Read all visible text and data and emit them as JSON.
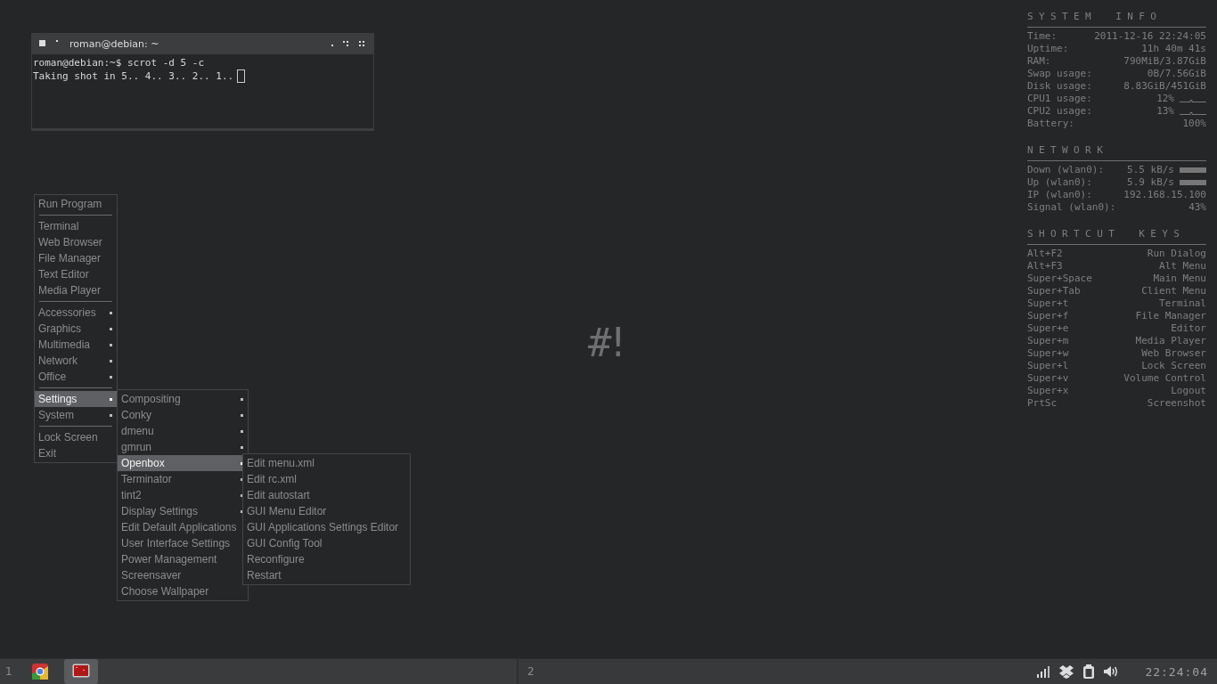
{
  "terminal": {
    "title": "roman@debian: ~",
    "lines": [
      "roman@debian:~$ scrot -d 5 -c",
      "Taking shot in 5.. 4.. 3.. 2.. 1.."
    ]
  },
  "menus": [
    {
      "items": [
        {
          "kind": "item",
          "label": "Run Program",
          "submenu": false,
          "selected": false
        },
        {
          "kind": "separator"
        },
        {
          "kind": "item",
          "label": "Terminal",
          "submenu": false,
          "selected": false
        },
        {
          "kind": "item",
          "label": "Web Browser",
          "submenu": false,
          "selected": false
        },
        {
          "kind": "item",
          "label": "File Manager",
          "submenu": false,
          "selected": false
        },
        {
          "kind": "item",
          "label": "Text Editor",
          "submenu": false,
          "selected": false
        },
        {
          "kind": "item",
          "label": "Media Player",
          "submenu": false,
          "selected": false
        },
        {
          "kind": "separator"
        },
        {
          "kind": "item",
          "label": "Accessories",
          "submenu": true,
          "selected": false
        },
        {
          "kind": "item",
          "label": "Graphics",
          "submenu": true,
          "selected": false
        },
        {
          "kind": "item",
          "label": "Multimedia",
          "submenu": true,
          "selected": false
        },
        {
          "kind": "item",
          "label": "Network",
          "submenu": true,
          "selected": false
        },
        {
          "kind": "item",
          "label": "Office",
          "submenu": true,
          "selected": false
        },
        {
          "kind": "separator"
        },
        {
          "kind": "item",
          "label": "Settings",
          "submenu": true,
          "selected": true
        },
        {
          "kind": "item",
          "label": "System",
          "submenu": true,
          "selected": false
        },
        {
          "kind": "separator"
        },
        {
          "kind": "item",
          "label": "Lock Screen",
          "submenu": false,
          "selected": false
        },
        {
          "kind": "item",
          "label": "Exit",
          "submenu": false,
          "selected": false
        }
      ]
    },
    {
      "items": [
        {
          "kind": "item",
          "label": "Compositing",
          "submenu": true,
          "selected": false
        },
        {
          "kind": "item",
          "label": "Conky",
          "submenu": true,
          "selected": false
        },
        {
          "kind": "item",
          "label": "dmenu",
          "submenu": true,
          "selected": false
        },
        {
          "kind": "item",
          "label": "gmrun",
          "submenu": true,
          "selected": false
        },
        {
          "kind": "item",
          "label": "Openbox",
          "submenu": true,
          "selected": true
        },
        {
          "kind": "item",
          "label": "Terminator",
          "submenu": true,
          "selected": false
        },
        {
          "kind": "item",
          "label": "tint2",
          "submenu": true,
          "selected": false
        },
        {
          "kind": "item",
          "label": "Display Settings",
          "submenu": true,
          "selected": false
        },
        {
          "kind": "item",
          "label": "Edit Default Applications",
          "submenu": false,
          "selected": false
        },
        {
          "kind": "item",
          "label": "User Interface Settings",
          "submenu": false,
          "selected": false
        },
        {
          "kind": "item",
          "label": "Power Management",
          "submenu": false,
          "selected": false
        },
        {
          "kind": "item",
          "label": "Screensaver",
          "submenu": false,
          "selected": false
        },
        {
          "kind": "item",
          "label": "Choose Wallpaper",
          "submenu": false,
          "selected": false
        }
      ]
    },
    {
      "items": [
        {
          "kind": "item",
          "label": "Edit menu.xml",
          "submenu": false,
          "selected": false
        },
        {
          "kind": "item",
          "label": "Edit rc.xml",
          "submenu": false,
          "selected": false
        },
        {
          "kind": "item",
          "label": "Edit autostart",
          "submenu": false,
          "selected": false
        },
        {
          "kind": "item",
          "label": "GUI Menu Editor",
          "submenu": false,
          "selected": false
        },
        {
          "kind": "item",
          "label": "GUI Applications Settings Editor",
          "submenu": false,
          "selected": false
        },
        {
          "kind": "item",
          "label": "GUI Config Tool",
          "submenu": false,
          "selected": false
        },
        {
          "kind": "item",
          "label": "Reconfigure",
          "submenu": false,
          "selected": false
        },
        {
          "kind": "item",
          "label": "Restart",
          "submenu": false,
          "selected": false
        }
      ]
    }
  ],
  "desktop_logo": "#!",
  "conky": [
    {
      "title": "SYSTEM INFO",
      "rows": [
        {
          "kind": "plain",
          "label": "Time:",
          "value": "2011-12-16 22:24:05"
        },
        {
          "kind": "plain",
          "label": "Uptime:",
          "value": "11h 40m 41s"
        },
        {
          "kind": "plain",
          "label": "RAM:",
          "value": "790MiB/3.87GiB"
        },
        {
          "kind": "plain",
          "label": "Swap usage:",
          "value": "0B/7.56GiB"
        },
        {
          "kind": "plain",
          "label": "Disk usage:",
          "value": "8.83GiB/451GiB"
        },
        {
          "kind": "graph",
          "label": "CPU1 usage:",
          "value": "12%"
        },
        {
          "kind": "graph",
          "label": "CPU2 usage:",
          "value": "13%"
        },
        {
          "kind": "plain",
          "label": "Battery:",
          "value": "100%"
        }
      ]
    },
    {
      "title": "NETWORK",
      "rows": [
        {
          "kind": "bar",
          "label": "Down (wlan0):",
          "value": "5.5 kB/s"
        },
        {
          "kind": "bar",
          "label": "Up (wlan0):",
          "value": "5.9 kB/s"
        },
        {
          "kind": "plain",
          "label": "IP (wlan0):",
          "value": "192.168.15.100"
        },
        {
          "kind": "plain",
          "label": "Signal (wlan0):",
          "value": "43%"
        }
      ]
    },
    {
      "title": "SHORTCUT KEYS",
      "rows": [
        {
          "kind": "plain",
          "label": "Alt+F2",
          "value": "Run Dialog"
        },
        {
          "kind": "plain",
          "label": "Alt+F3",
          "value": "Alt Menu"
        },
        {
          "kind": "plain",
          "label": "Super+Space",
          "value": "Main Menu"
        },
        {
          "kind": "plain",
          "label": "Super+Tab",
          "value": "Client Menu"
        },
        {
          "kind": "plain",
          "label": "Super+t",
          "value": "Terminal"
        },
        {
          "kind": "plain",
          "label": "Super+f",
          "value": "File Manager"
        },
        {
          "kind": "plain",
          "label": "Super+e",
          "value": "Editor"
        },
        {
          "kind": "plain",
          "label": "Super+m",
          "value": "Media Player"
        },
        {
          "kind": "plain",
          "label": "Super+w",
          "value": "Web Browser"
        },
        {
          "kind": "plain",
          "label": "Super+l",
          "value": "Lock Screen"
        },
        {
          "kind": "plain",
          "label": "Super+v",
          "value": "Volume Control"
        },
        {
          "kind": "plain",
          "label": "Super+x",
          "value": "Logout"
        },
        {
          "kind": "plain",
          "label": "PrtSc",
          "value": "Screenshot"
        }
      ]
    }
  ],
  "taskbar": {
    "desktops": [
      {
        "label": "1",
        "tasks": [
          {
            "kind": "browser",
            "selected": false
          },
          {
            "kind": "terminal",
            "selected": true
          }
        ]
      },
      {
        "label": "2"
      }
    ],
    "tray": [
      {
        "kind": "signal"
      },
      {
        "kind": "box"
      },
      {
        "kind": "battery"
      },
      {
        "kind": "volume"
      }
    ],
    "clock": "22:24:04"
  }
}
